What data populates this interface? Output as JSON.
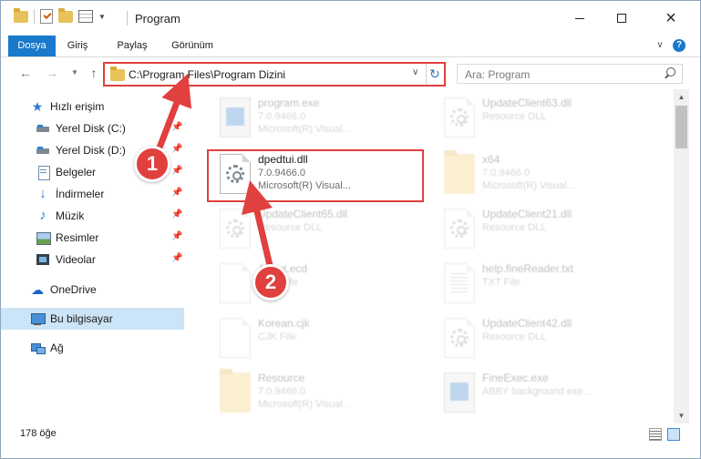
{
  "window": {
    "title": "Program",
    "controls": {
      "minimize": "minimize",
      "maximize": "maximize",
      "close": "×"
    }
  },
  "ribbon": {
    "tabs": [
      "Dosya",
      "Giriş",
      "Paylaş",
      "Görünüm"
    ],
    "help": "?"
  },
  "nav": {
    "address": "C:\\Program Files\\Program Dizini",
    "search_placeholder": "Ara: Program"
  },
  "sidebar": {
    "items": [
      {
        "label": "Hızlı erişim",
        "icon": "star-icon",
        "pinned": false
      },
      {
        "label": "Yerel Disk (C:)",
        "icon": "drive-icon",
        "pinned": true
      },
      {
        "label": "Yerel Disk (D:)",
        "icon": "drive-icon",
        "pinned": true
      },
      {
        "label": "Belgeler",
        "icon": "documents-icon",
        "pinned": true
      },
      {
        "label": "İndirmeler",
        "icon": "downloads-icon",
        "pinned": true
      },
      {
        "label": "Müzik",
        "icon": "music-icon",
        "pinned": true
      },
      {
        "label": "Resimler",
        "icon": "pictures-icon",
        "pinned": true
      },
      {
        "label": "Videolar",
        "icon": "videos-icon",
        "pinned": true
      },
      {
        "label": "OneDrive",
        "icon": "onedrive-icon",
        "pinned": false
      },
      {
        "label": "Bu bilgisayar",
        "icon": "this-pc-icon",
        "pinned": false,
        "selected": true
      },
      {
        "label": "Ağ",
        "icon": "network-icon",
        "pinned": false
      }
    ]
  },
  "files": [
    {
      "name": "program.exe",
      "line1": "7.0.9466.0",
      "line2": "Microsoft(R) Visual...",
      "icon": "exe-icon",
      "highlighted": false
    },
    {
      "name": "UpdateClient63.dll",
      "line1": "Resource DLL",
      "line2": "",
      "icon": "dll-icon",
      "highlighted": false
    },
    {
      "name": "dpedtui.dll",
      "line1": "7.0.9466.0",
      "line2": "Microsoft(R) Visual...",
      "icon": "dll-gear-icon",
      "highlighted": true
    },
    {
      "name": "x64",
      "line1": "7.0.9466.0",
      "line2": "Microsoft(R) Visual...",
      "icon": "folder-icon",
      "highlighted": false
    },
    {
      "name": "UpdateClient65.dll",
      "line1": "Resource DLL",
      "line2": "",
      "icon": "dll-icon",
      "highlighted": false
    },
    {
      "name": "UpdateClient21.dll",
      "line1": "Resource DLL",
      "line2": "",
      "icon": "dll-icon",
      "highlighted": false
    },
    {
      "name": "About.ecd",
      "line1": "ECD File",
      "line2": "",
      "icon": "file-icon",
      "highlighted": false
    },
    {
      "name": "help.fineReader.txt",
      "line1": "TXT File",
      "line2": "",
      "icon": "text-file-icon",
      "highlighted": false
    },
    {
      "name": "Korean.cjk",
      "line1": "CJK File",
      "line2": "",
      "icon": "file-icon",
      "highlighted": false
    },
    {
      "name": "UpdateClient42.dll",
      "line1": "Resource DLL",
      "line2": "",
      "icon": "dll-icon",
      "highlighted": false
    },
    {
      "name": "Resource",
      "line1": "7.0.9466.0",
      "line2": "Microsoft(R) Visual...",
      "icon": "folder-icon",
      "highlighted": false
    },
    {
      "name": "FineExec.exe",
      "line1": "ABBY background exe...",
      "line2": "",
      "icon": "exe-icon",
      "highlighted": false
    }
  ],
  "status": {
    "item_count": "178 öğe"
  },
  "annotations": {
    "step1": "1",
    "step2": "2",
    "color": "#e0403e"
  },
  "colors": {
    "accent": "#1979ca",
    "selection": "#cce4f7",
    "annotation_red": "#e0403e"
  }
}
